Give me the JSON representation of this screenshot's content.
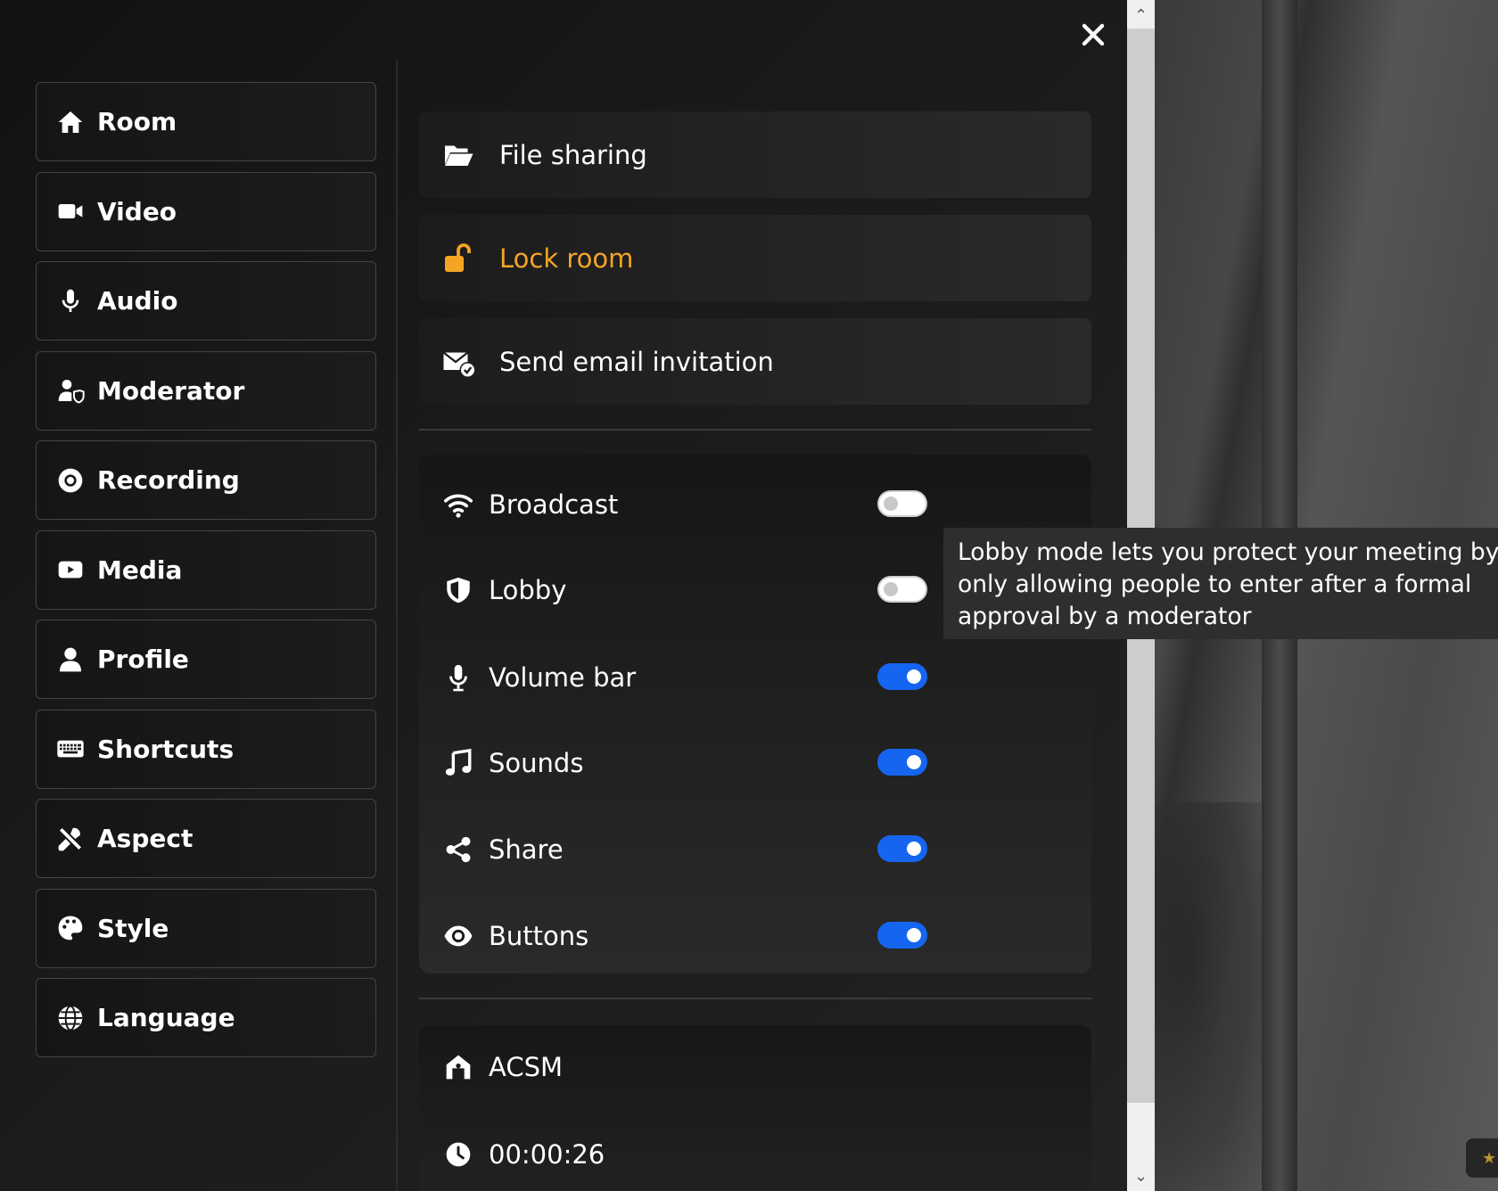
{
  "nav": {
    "items": [
      {
        "label": "Room",
        "icon": "home-icon"
      },
      {
        "label": "Video",
        "icon": "video-camera-icon"
      },
      {
        "label": "Audio",
        "icon": "microphone-icon"
      },
      {
        "label": "Moderator",
        "icon": "user-shield-icon"
      },
      {
        "label": "Recording",
        "icon": "record-icon"
      },
      {
        "label": "Media",
        "icon": "play-icon"
      },
      {
        "label": "Profile",
        "icon": "user-icon"
      },
      {
        "label": "Shortcuts",
        "icon": "keyboard-icon"
      },
      {
        "label": "Aspect",
        "icon": "tools-icon"
      },
      {
        "label": "Style",
        "icon": "palette-icon"
      },
      {
        "label": "Language",
        "icon": "globe-icon"
      }
    ]
  },
  "actions": {
    "file_sharing": "File sharing",
    "lock_room": "Lock room",
    "send_email": "Send email invitation"
  },
  "toggles": [
    {
      "label": "Broadcast",
      "on": false,
      "icon": "wifi-icon"
    },
    {
      "label": "Lobby",
      "on": false,
      "icon": "shield-icon"
    },
    {
      "label": "Volume bar",
      "on": true,
      "icon": "microphone-icon"
    },
    {
      "label": "Sounds",
      "on": true,
      "icon": "music-icon"
    },
    {
      "label": "Share",
      "on": true,
      "icon": "share-icon"
    },
    {
      "label": "Buttons",
      "on": true,
      "icon": "eye-icon"
    }
  ],
  "info": {
    "room_name": "ACSM",
    "timer": "00:00:26"
  },
  "tooltip": {
    "text": "Lobby mode lets you protect your meeting by only allowing people to enter after a formal approval by a moderator"
  },
  "colors": {
    "accent_blue": "#1565f0",
    "warning_orange": "#f5a524"
  }
}
